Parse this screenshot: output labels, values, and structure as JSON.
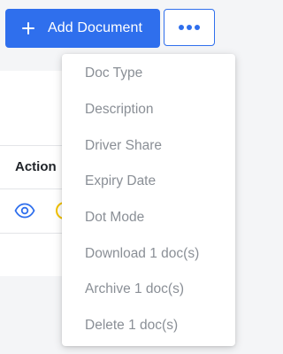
{
  "toolbar": {
    "add_document_label": "Add Document",
    "more_icon": "more-horizontal-icon",
    "accent_color": "#2f6fed"
  },
  "table": {
    "columns": [
      "Action"
    ],
    "rows": [
      {
        "actions": [
          "eye-icon",
          "edit-icon"
        ]
      }
    ]
  },
  "menu": {
    "items": [
      {
        "label": "Doc Type"
      },
      {
        "label": "Description"
      },
      {
        "label": "Driver Share"
      },
      {
        "label": "Expiry Date"
      },
      {
        "label": "Dot Mode"
      },
      {
        "label": "Download 1 doc(s)"
      },
      {
        "label": "Archive 1 doc(s)"
      },
      {
        "label": "Delete 1 doc(s)"
      }
    ]
  }
}
